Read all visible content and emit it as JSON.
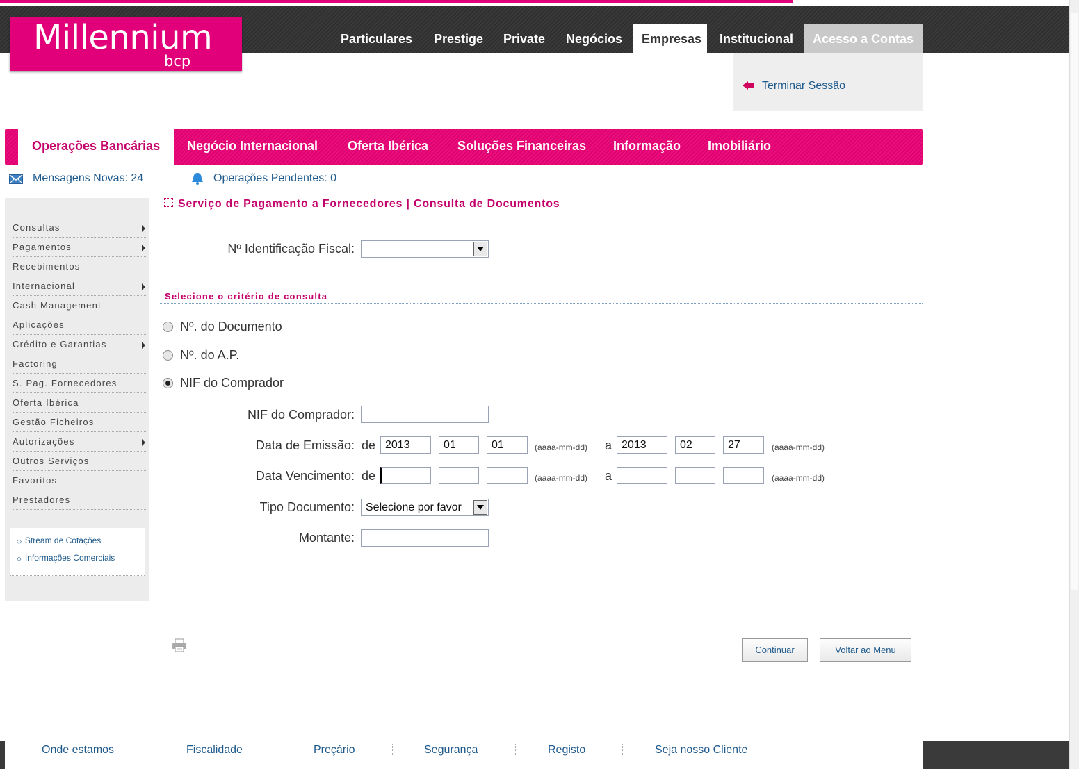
{
  "brand": {
    "name": "Millennium",
    "sub": "bcp",
    "color": "#e2007a"
  },
  "top_nav": [
    "Particulares",
    "Prestige",
    "Private",
    "Negócios",
    "Empresas",
    "Institucional",
    "Acesso a Contas"
  ],
  "top_nav_active": "Empresas",
  "session": {
    "logout_label": "Terminar Sessão"
  },
  "main_nav": [
    "Operações Bancárias",
    "Negócio Internacional",
    "Oferta Ibérica",
    "Soluções Financeiras",
    "Informação",
    "Imobiliário"
  ],
  "main_nav_active": "Operações Bancárias",
  "status": {
    "messages": "Mensagens Novas: 24",
    "pending": "Operações Pendentes: 0"
  },
  "sidebar": {
    "items": [
      "Consultas",
      "Pagamentos",
      "Recebimentos",
      "Internacional",
      "Cash Management",
      "Aplicações",
      "Crédito e Garantias",
      "Factoring",
      "S. Pag. Fornecedores",
      "Oferta Ibérica",
      "Gestão Ficheiros",
      "Autorizações",
      "Outros Serviços",
      "Favoritos",
      "Prestadores"
    ],
    "links": [
      "Stream de Cotações",
      "Informações Comerciais"
    ]
  },
  "page": {
    "title": "Serviço de Pagamento a Fornecedores | Consulta de Documentos",
    "nif_label": "Nº Identificação Fiscal:",
    "nif_value": "",
    "criteria_title": "Selecione o critério de consulta",
    "radios": [
      "Nº. do Documento",
      "Nº. do A.P.",
      "NIF do Comprador"
    ],
    "selected_radio": "NIF do Comprador",
    "buyer_nif_label": "NIF do Comprador:",
    "buyer_nif_value": "",
    "emission_label": "Data de Emissão:",
    "emission_from": {
      "year": "2013",
      "month": "01",
      "day": "01"
    },
    "emission_to": {
      "year": "2013",
      "month": "02",
      "day": "27"
    },
    "due_label": "Data Vencimento:",
    "due_from": {
      "year": "",
      "month": "",
      "day": ""
    },
    "due_to": {
      "year": "",
      "month": "",
      "day": ""
    },
    "word_de": "de",
    "word_a": "a",
    "date_hint": "(aaaa-mm-dd)",
    "doctype_label": "Tipo Documento:",
    "doctype_value": "Selecione por favor",
    "amount_label": "Montante:",
    "amount_value": "",
    "continue_button": "Continuar",
    "back_button": "Voltar ao Menu"
  },
  "footer": [
    "Onde estamos",
    "Fiscalidade",
    "Preçário",
    "Segurança",
    "Registo",
    "Seja nosso Cliente"
  ]
}
